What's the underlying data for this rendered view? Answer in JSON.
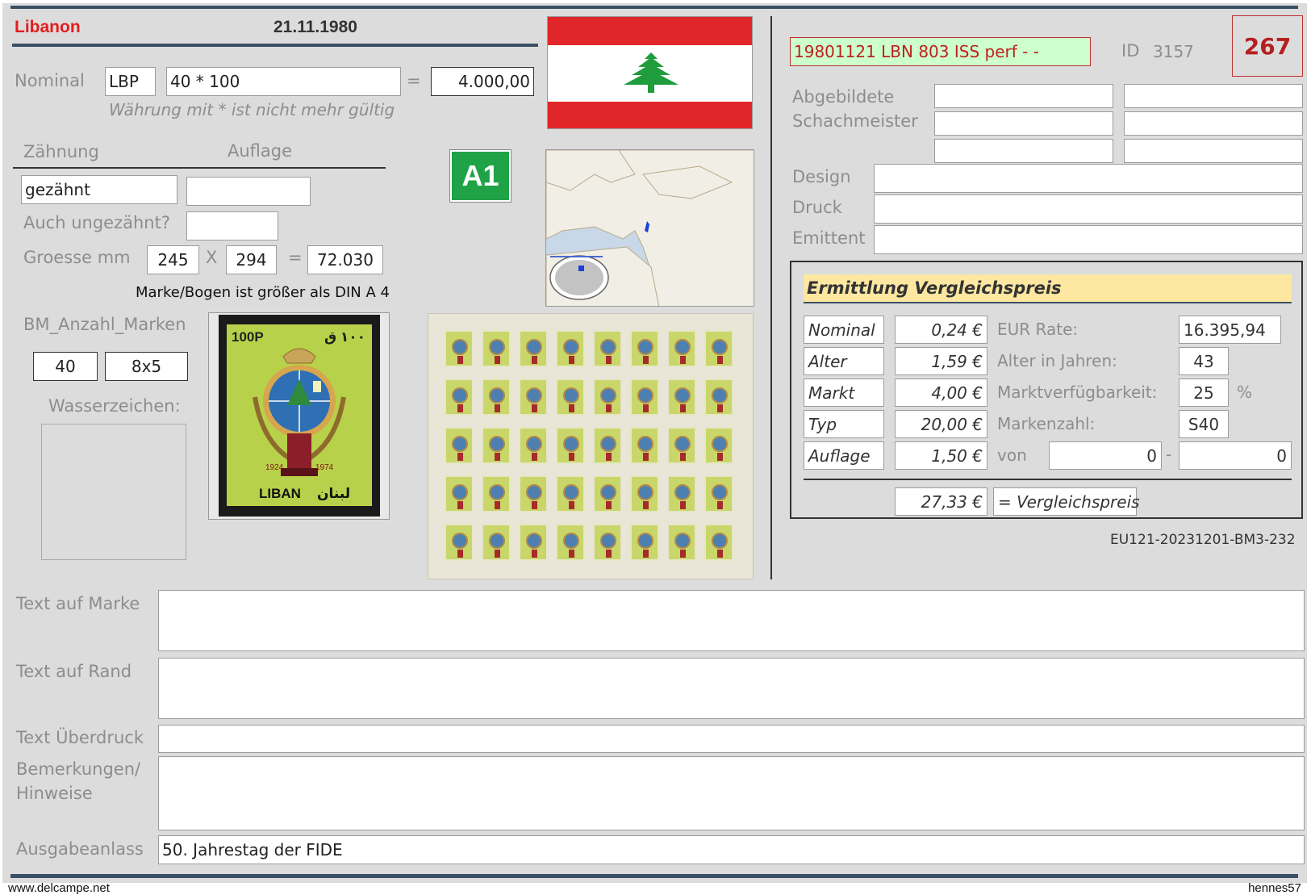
{
  "header": {
    "country": "Libanon",
    "date": "21.11.1980"
  },
  "nominal": {
    "label": "Nominal",
    "currency": "LBP",
    "expression": "40 * 100",
    "equals": "=",
    "result": "4.000,00",
    "note": "Währung mit * ist nicht mehr gültig"
  },
  "perforation": {
    "zaehnung_label": "Zähnung",
    "auflage_label": "Auflage",
    "zaehnung_value": "gezähnt",
    "auflage_value": "",
    "imperf_label": "Auch ungezähnt?",
    "imperf_value": ""
  },
  "size": {
    "label": "Groesse mm",
    "width": "245",
    "times": "X",
    "height": "294",
    "equals": "=",
    "area": "72.030",
    "note": "Marke/Bogen ist größer als DIN A 4"
  },
  "sheet": {
    "label": "BM_Anzahl_Marken",
    "count": "40",
    "layout": "8x5",
    "watermark_label": "Wasserzeichen:"
  },
  "badge": "A1",
  "stamp": {
    "value_latin": "100P",
    "value_arabic": "١٠٠ ق",
    "years_left": "1924",
    "years_right": "1974",
    "country_latin": "LIBAN",
    "country_arabic": "لبنان"
  },
  "catalog": {
    "code": "19801121 LBN 803 ISS perf - -",
    "id_label": "ID",
    "id_value": "3157",
    "number": "267"
  },
  "people": {
    "abgebildete": "Abgebildete",
    "schachmeister": "Schachmeister",
    "design": "Design",
    "druck": "Druck",
    "emittent": "Emittent"
  },
  "price": {
    "title": "Ermittlung Vergleichspreis",
    "rows": [
      {
        "label": "Nominal",
        "value": "0,24 €",
        "desc": "EUR Rate:",
        "info": "16.395,94"
      },
      {
        "label": "Alter",
        "value": "1,59 €",
        "desc": "Alter in Jahren:",
        "info": "43"
      },
      {
        "label": "Markt",
        "value": "4,00 €",
        "desc": "Marktverfügbarkeit:",
        "info": "25",
        "unit": "%"
      },
      {
        "label": "Typ",
        "value": "20,00 €",
        "desc": "Markenzahl:",
        "info": "S40"
      },
      {
        "label": "Auflage",
        "value": "1,50 €",
        "desc": "von",
        "from": "0",
        "dash": "-",
        "to": "0"
      }
    ],
    "total": "27,33 €",
    "total_label": "= Vergleichspreis"
  },
  "reference": "EU121-20231201-BM3-232",
  "texts": {
    "marke_label": "Text auf Marke",
    "rand_label": "Text auf Rand",
    "ueberdruck_label": "Text Überdruck",
    "bemerkungen_label1": "Bemerkungen/",
    "bemerkungen_label2": "Hinweise",
    "anlass_label": "Ausgabeanlass",
    "anlass_value": "50. Jahrestag der FIDE"
  },
  "footer": {
    "left": "www.delcampe.net",
    "right": "hennes57"
  },
  "colors": {
    "accent_bar": "#3a5066",
    "country_red": "#e21e1e",
    "badge_green": "#1fa346",
    "code_bg": "#ccffcc",
    "price_header": "#fde7a1",
    "number_red": "#b51f1f"
  }
}
